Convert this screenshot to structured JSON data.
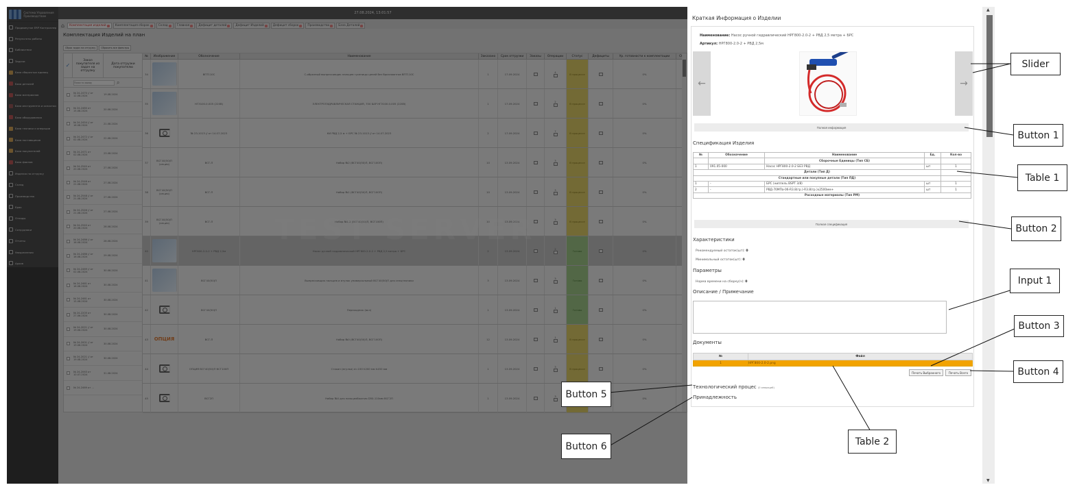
{
  "app": {
    "datetime": "27.08.2024, 13:01:57",
    "logo_text": "Система Управления Производством",
    "page_title": "Комплектация Изделий на план",
    "watermark": "TEST SERVER"
  },
  "sidebar": {
    "items": [
      {
        "label": "Продвинутое ERP Контроллер",
        "icon": "grid-icon",
        "color": ""
      },
      {
        "label": "Результаты работы",
        "icon": "chart-icon",
        "color": ""
      },
      {
        "label": "Библиотеки",
        "icon": "book-icon",
        "color": ""
      },
      {
        "label": "Задачи",
        "icon": "task-icon",
        "color": ""
      },
      {
        "label": "База сборочных единиц",
        "icon": "box-icon",
        "color": "c1"
      },
      {
        "label": "База деталей",
        "icon": "box-icon",
        "color": "c2"
      },
      {
        "label": "База материалов",
        "icon": "box-icon",
        "color": "c2"
      },
      {
        "label": "База инструмента и оснастки",
        "icon": "box-icon",
        "color": "c3"
      },
      {
        "label": "База оборудования",
        "icon": "box-icon",
        "color": "c2"
      },
      {
        "label": "База техники и операции",
        "icon": "box-icon",
        "color": "c1"
      },
      {
        "label": "База поставщиков",
        "icon": "box-icon",
        "color": "c1"
      },
      {
        "label": "База покупателей",
        "icon": "box-icon",
        "color": "c1"
      },
      {
        "label": "База фаилов",
        "icon": "box-icon",
        "color": "c2"
      },
      {
        "label": "Изделия на отгрузку",
        "icon": "truck-icon",
        "color": ""
      },
      {
        "label": "Склад",
        "icon": "warehouse-icon",
        "color": ""
      },
      {
        "label": "Производство",
        "icon": "factory-icon",
        "color": ""
      },
      {
        "label": "Брак",
        "icon": "warning-icon",
        "color": ""
      },
      {
        "label": "Отходы",
        "icon": "recycle-icon",
        "color": ""
      },
      {
        "label": "Сотрудники",
        "icon": "users-icon",
        "color": ""
      },
      {
        "label": "Отчеты",
        "icon": "report-icon",
        "color": ""
      },
      {
        "label": "Уведомления",
        "icon": "bell-icon",
        "color": ""
      },
      {
        "label": "Архив",
        "icon": "archive-icon",
        "color": ""
      }
    ]
  },
  "tabs": [
    {
      "label": "Комплектация изделий",
      "active": true
    },
    {
      "label": "Комплектация сборок",
      "active": false
    },
    {
      "label": "Склад",
      "active": false
    },
    {
      "label": "Главная",
      "active": false
    },
    {
      "label": "Дефицит деталей",
      "active": false
    },
    {
      "label": "Дефицит Изделий",
      "active": false
    },
    {
      "label": "Дефицит сборок",
      "active": false
    },
    {
      "label": "Производство",
      "active": false
    },
    {
      "label": "База Деталей",
      "active": false
    }
  ],
  "left_panel": {
    "btn_reset_orders": "Сброс задач на отгрузку",
    "btn_reset_filters": "Сбросить все фильтры",
    "col_order": "Заказ покупателя из задач на отгрузку",
    "col_date": "Дата отгрузки покупателю",
    "search_placeholder": "Поиск по заказу",
    "rows": [
      {
        "order": "№ 24-2470 // от 12.08.2024",
        "date": "19.08.2024"
      },
      {
        "order": "№ 24-2480 от 15.08.2024",
        "date": "20.08.2024"
      },
      {
        "order": "№ 24-2454 // от 16.08.2024",
        "date": "21.08.2024"
      },
      {
        "order": "№ 24-2472 // от 02.08.2024",
        "date": "22.08.2024"
      },
      {
        "order": "№ 24-2471 от 02.08.2024",
        "date": "23.08.2024"
      },
      {
        "order": "№ 24-2540 от 20.08.2024",
        "date": "27.08.2024"
      },
      {
        "order": "№ 24-2546 от 21.08.2024",
        "date": "27.08.2024"
      },
      {
        "order": "№ 24-2548 // от 21.08.2024",
        "date": "27.08.2024"
      },
      {
        "order": "№ 24-2546 // от 21.08.2024",
        "date": "27.08.2024"
      },
      {
        "order": "№ 24-2540 от 20.08.2024",
        "date": "28.08.2024"
      },
      {
        "order": "№ 24-2486 // от 16.08.2024",
        "date": "28.08.2024"
      },
      {
        "order": "№ 24-2486 // от 16.08.2024",
        "date": "29.08.2024"
      },
      {
        "order": "№ 24-2469 // от 02.08.2024",
        "date": "30.08.2024"
      },
      {
        "order": "№ 24-2461 от 16.08.2024",
        "date": "30.08.2024"
      },
      {
        "order": "№ 24-2461 от 15.08.2024",
        "date": "30.08.2024"
      },
      {
        "order": "№ 24-2205 от 27.06.2024",
        "date": "30.08.2024"
      },
      {
        "order": "№ 24-2021 // от 19.06.2024",
        "date": "30.08.2024"
      },
      {
        "order": "№ 24-2001 // от 19.06.2024",
        "date": "30.08.2024"
      },
      {
        "order": "№ 24-2021 // от 19.08.2024",
        "date": "30.08.2024"
      },
      {
        "order": "№ 24-2063 от 10.07.2024",
        "date": "31.08.2024"
      },
      {
        "order": "№ 24-2469 от ...",
        "date": ""
      }
    ]
  },
  "main_table": {
    "headers": [
      "№",
      "Изображение",
      "Обозначение",
      "Наименование",
      "Заказано",
      "Срок отгрузки",
      "Заказы",
      "Операции",
      "Статус",
      "Дефициты",
      "Ур. готовности к комплектации",
      "Сб"
    ],
    "rows": [
      {
        "n": "34",
        "img": "pic",
        "code": "ВПТ110С",
        "name": "С-образный выпрессовщик пальцев гусеницы цепей без бриллиантов ВПТ110С",
        "qty": "1",
        "date": "17.09.2024",
        "ops": "4",
        "status": "В процессе",
        "st": "y",
        "pct": "0%"
      },
      {
        "n": "35",
        "img": "pic",
        "code": "НГЭ100.0.005 (220В)",
        "name": "ЭЛЕКТРОГИДРАВЛИЧЕСКАЯ СТАНЦИЯ, 700 БАР НГЭ100.0.005 (220В)",
        "qty": "1",
        "date": "17.09.2024",
        "ops": "2",
        "status": "В процессе",
        "st": "y",
        "pct": "0%"
      },
      {
        "n": "36",
        "img": "cam",
        "code": "№ 23-1013 // от 14.07.2023",
        "name": "КИ РВД 2,5 м + БРС № 23-1013 // от 14.07.2023",
        "qty": "2",
        "date": "17.09.2024",
        "ops": "7",
        "status": "В процессе",
        "st": "y",
        "pct": "0%"
      },
      {
        "n": "37",
        "img": "text",
        "imgtext": "ВСГ40(50)П (опция)",
        "code": "ВСГ-П",
        "name": "Набор №2 (ВСГ40(50)П, ВСГ100П)",
        "qty": "10",
        "date": "13.09.2024",
        "ops": "3",
        "status": "В процессе",
        "st": "y",
        "pct": "0%"
      },
      {
        "n": "38",
        "img": "text",
        "imgtext": "ВСГ40(50)П (опция)",
        "code": "ВСГ-П",
        "name": "Набор №1 (ВСГ40(50)П, ВСГ100П)",
        "qty": "10",
        "date": "13.09.2024",
        "ops": "3",
        "status": "В процессе",
        "st": "y",
        "pct": "0%"
      },
      {
        "n": "39",
        "img": "text",
        "imgtext": "ВСГ40(50)П (опция)",
        "code": "ВСГ-П",
        "name": "Набор №1.2 (ВСГ40(50)П, ВСГ100П)",
        "qty": "10",
        "date": "13.09.2024",
        "ops": "3",
        "status": "В процессе",
        "st": "y",
        "pct": "0%"
      },
      {
        "n": "40",
        "img": "pic",
        "code": "НРГ800-2.0-2 + РВД 2,5м",
        "name": "Насос ручной гидравлический НРГ800-2.0-2 + РВД 2,5 метра + БРС",
        "qty": "2",
        "date": "13.09.2024",
        "ops": "2",
        "status": "Готово",
        "st": "g",
        "pct": "0%",
        "sel": true
      },
      {
        "n": "41",
        "img": "pic",
        "code": "ВСГ40(50)П",
        "name": "Выпрессовщик пальцев и втулок универсальный ВСГ40(50)П для спецтехники",
        "qty": "3",
        "date": "13.09.2024",
        "ops": "3",
        "status": "Готово",
        "st": "g",
        "pct": "0%"
      },
      {
        "n": "42",
        "img": "cam",
        "code": "ВСГ40(50)П",
        "name": "Переходник (вкл)",
        "qty": "1",
        "date": "13.09.2024",
        "ops": "1",
        "status": "Готово",
        "st": "g",
        "pct": "0%"
      },
      {
        "n": "43",
        "img": "opc",
        "imgtext": "ОПЦИЯ",
        "code": "ВСГ-П",
        "name": "Набор №0 (ВСГ40(50)П, ВСГ100П)",
        "qty": "12",
        "date": "13.09.2024",
        "ops": "1",
        "status": "В процессе",
        "st": "y",
        "pct": "0%"
      },
      {
        "n": "44",
        "img": "cam",
        "code": "ОПЦИЯ ВСГ40(50)П ВСГ100П",
        "name": "Стакан (втулка) d=150 h200 мм h450 мм",
        "qty": "1",
        "date": "13.09.2024",
        "ops": "3",
        "status": "В процессе",
        "st": "y",
        "pct": "0%"
      },
      {
        "n": "45",
        "img": "cam",
        "code": "ВСГ2П",
        "name": "Набор №4 для пальцеобжатия D50-110мм ВСГ2П",
        "qty": "1",
        "date": "13.09.2024",
        "ops": "3",
        "status": "В процессе",
        "st": "y",
        "pct": "0%"
      }
    ]
  },
  "panel": {
    "title": "Краткая Информация о Изделии",
    "name_label": "Наименование:",
    "name_value": "Насос ручной гидравлический НРГ800-2.0-2 + РВД 2,5 метра + БРС",
    "article_label": "Артикул:",
    "article_value": "НРГ800-2.0-2 + РВД 2,5м",
    "prev_arrow": "←",
    "next_arrow": "→",
    "full_info_btn": "Полная информация",
    "spec_title": "Спецификация Изделия",
    "spec_headers": [
      "№",
      "Обозначение",
      "Наименование",
      "Ед.",
      "Кол-во"
    ],
    "spec_group_1": "Сборочные Единицы (Тип СБ)",
    "spec_group_2": "Детали (Тип Д)",
    "spec_group_3": "Стандартные или покупные детали (Тип ПД)",
    "spec_group_4": "Расходные материалы (Тип РМ)",
    "spec_row_sb": {
      "n": "1",
      "code": "091.05-000",
      "name": "Насос НРГ800-2.0-2 БЕЗ РВД",
      "unit": "шт",
      "qty": "1"
    },
    "spec_row_pd1": {
      "n": "1",
      "code": "-",
      "name": "БРС (ниппель BSPT 3/8)",
      "unit": "шт",
      "qty": "1"
    },
    "spec_row_pd2": {
      "n": "2",
      "code": "-",
      "name": "РВД-70МПа-06-R3.8(гр.)-R3.8(гр.)x2500мм+",
      "unit": "шт",
      "qty": "1"
    },
    "full_spec_btn": "Полная спецификация",
    "chars_title": "Характеристики",
    "rec_stock_label": "Рекомендуемый остаток(шт):",
    "rec_stock_value": "0",
    "min_stock_label": "Минимальный остаток(шт):",
    "min_stock_value": "0",
    "params_title": "Параметры",
    "assembly_time_label": "Норма времени на сборку(ч):",
    "assembly_time_value": "0",
    "desc_title": "Описание / Примечание",
    "desc_value": "",
    "docs_title": "Документы",
    "docs_headers": [
      "№",
      "Файл"
    ],
    "docs_row": {
      "n": "1",
      "file": "НРГ800-2.0-2.png"
    },
    "print_selected_btn": "Печать Выбранного",
    "print_all_btn": "Печать Всего",
    "tech_process": "Технологический процес",
    "tech_process_note": "(0 операций)",
    "belonging": "Принадлежность"
  },
  "callouts": {
    "slider": "Slider",
    "button1": "Button 1",
    "table1": "Table 1",
    "button2": "Button 2",
    "input1": "Input 1",
    "button3": "Button 3",
    "button4": "Button 4",
    "button5": "Button 5",
    "button6": "Button 6",
    "table2": "Table 2"
  },
  "colors": {
    "status_progress": "#e6d56a",
    "status_done": "#a4cf8c",
    "docs_highlight": "#f2a300"
  }
}
